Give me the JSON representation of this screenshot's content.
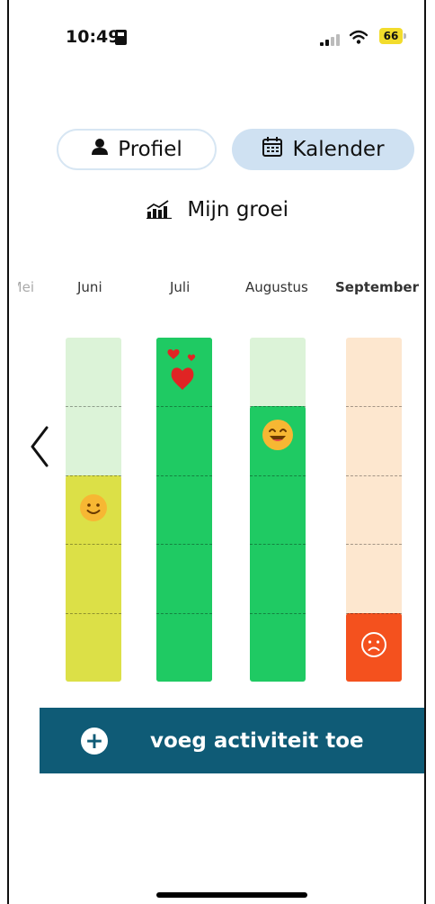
{
  "status_bar": {
    "time": "10:49",
    "battery": "66"
  },
  "tabs": [
    {
      "label": "Profiel",
      "icon": "person-icon"
    },
    {
      "label": "Kalender",
      "icon": "calendar-icon"
    }
  ],
  "growth": {
    "title": "Mijn groei",
    "icon": "growth-chart-icon"
  },
  "months": [
    "Mei",
    "Juni",
    "Juli",
    "Augustus",
    "September"
  ],
  "chart_data": {
    "type": "bar",
    "categories": [
      "Juni",
      "Juli",
      "Augustus",
      "September"
    ],
    "values": [
      0.6,
      1.0,
      0.8,
      0.2
    ],
    "mood_icons": [
      "smile-icon",
      "hearts-icon",
      "laughing-icon",
      "sad-icon"
    ],
    "colors": {
      "Juni": {
        "fill": "#dce047",
        "track": "#dcf3d8"
      },
      "Juli": {
        "fill": "#1fca63",
        "track": "#1fca63"
      },
      "Augustus": {
        "fill": "#1fca63",
        "track": "#dcf3d8"
      },
      "September": {
        "fill": "#f4511e",
        "track": "#fde7cf"
      }
    },
    "ylim": [
      0,
      1
    ]
  },
  "add_button": {
    "label": "voeg activiteit toe"
  },
  "colors": {
    "accent": "#0f5b76",
    "tab_active": "#cfe1f2",
    "tab_border": "#d7e6f3"
  }
}
